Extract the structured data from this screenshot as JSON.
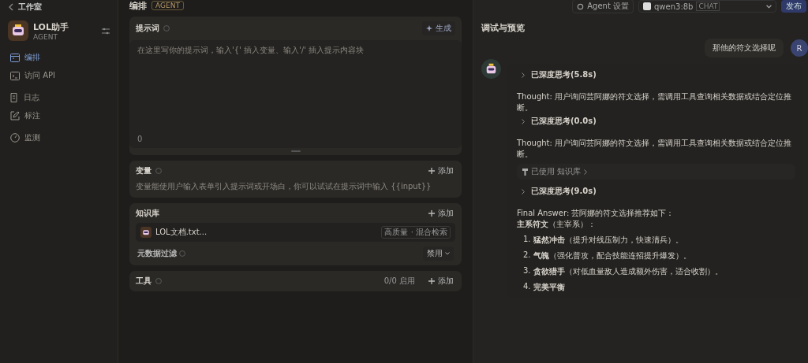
{
  "topbar": {
    "workspace": "工作室",
    "page_title": "编排",
    "badge": "AGENT",
    "agent_settings": "Agent 设置",
    "model": {
      "name": "qwen3:8b",
      "tag": "CHAT"
    },
    "publish": "发布"
  },
  "sidebar": {
    "app": {
      "name": "LOL助手",
      "type": "AGENT"
    },
    "items": [
      {
        "label": "编排",
        "selected": true
      },
      {
        "label": "访问 API",
        "selected": false
      },
      {
        "label": "日志",
        "selected": false
      },
      {
        "label": "标注",
        "selected": false
      },
      {
        "label": "监测",
        "selected": false
      }
    ]
  },
  "prompt": {
    "title": "提示词",
    "generate": "生成",
    "placeholder": "在这里写你的提示词，输入'{' 插入变量、输入'/' 插入提示内容块",
    "count": "0"
  },
  "variables": {
    "title": "变量",
    "add": "添加",
    "hint": "变量能使用户输入表单引入提示词或开场白，你可以试试在提示词中输入 {{input}}"
  },
  "knowledge": {
    "title": "知识库",
    "add": "添加",
    "files": [
      {
        "name": "LOL文档.txt...",
        "tag": "高质量 · 混合检索"
      }
    ],
    "metadata_filter": {
      "label": "元数据过滤",
      "value": "禁用"
    }
  },
  "tools": {
    "title": "工具",
    "count": "0/0 启用",
    "add": "添加"
  },
  "chat": {
    "title": "调试与预览",
    "user_avatar": "R",
    "user_message": "那他的符文选择呢",
    "reply": [
      {
        "kind": "thinking",
        "label": "已深度思考(5.8s)"
      },
      {
        "kind": "text",
        "text": "Thought: 用户询问芸阿娜的符文选择，需调用工具查询相关数据或结合定位推断。"
      },
      {
        "kind": "thinking",
        "label": "已深度思考(0.0s)"
      },
      {
        "kind": "text",
        "text": "Thought: 用户询问芸阿娜的符文选择，需调用工具查询相关数据或结合定位推断。"
      },
      {
        "kind": "tool",
        "label": "已使用",
        "tool": "知识库"
      },
      {
        "kind": "thinking",
        "label": "已深度思考(9.0s)"
      },
      {
        "kind": "answer",
        "lines": [
          "Final Answer: 芸阿娜的符文选择推荐如下：",
          "**主系符文**（主宰系）："
        ],
        "items": [
          {
            "number": "1.",
            "text": "**猛然冲击**（提升对线压制力，快速清兵）。"
          },
          {
            "number": "2.",
            "text": "**气魄**（强化普攻，配合技能连招提升爆发）。"
          },
          {
            "number": "3.",
            "text": "**贪欲猎手**（对低血量敌人造成额外伤害，适合收割）。"
          },
          {
            "number": "4.",
            "text": "**完美平衡**"
          }
        ]
      }
    ]
  }
}
